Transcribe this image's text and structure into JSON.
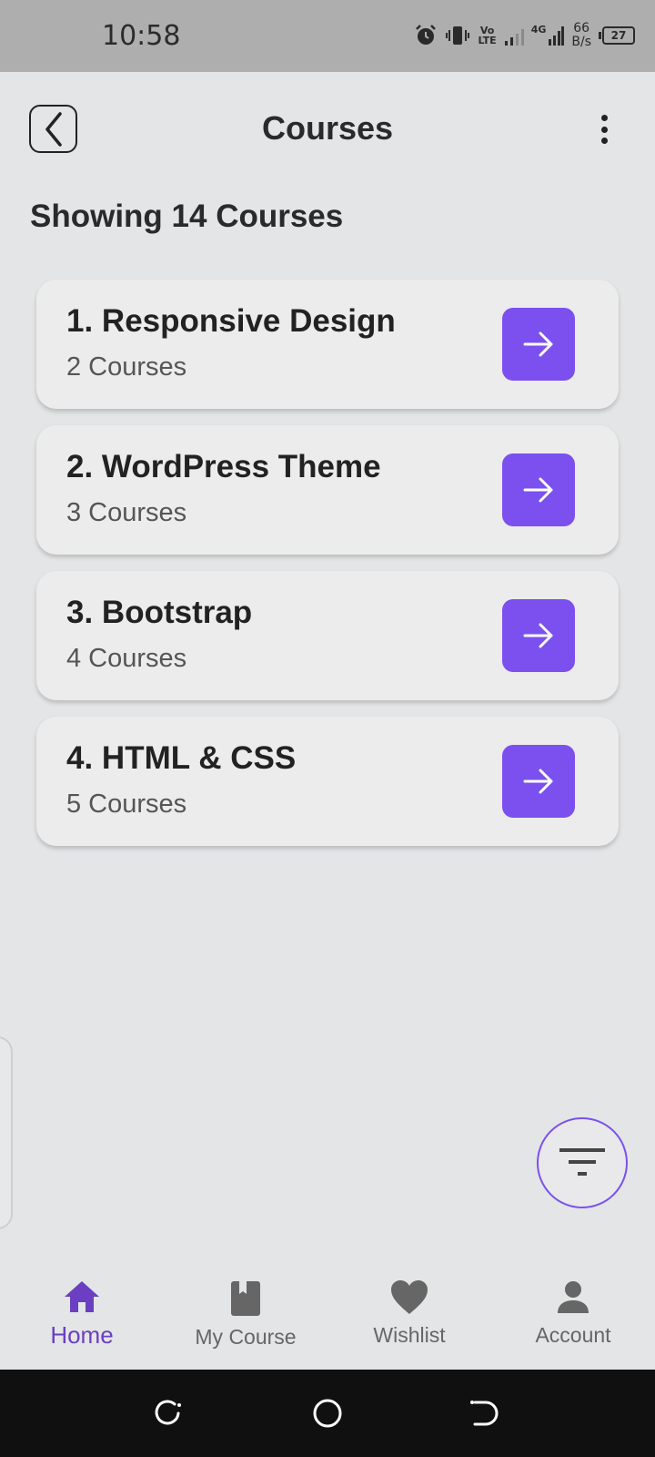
{
  "status_bar": {
    "time": "10:58",
    "network_vo": "Vo",
    "network_lte": "LTE",
    "network_4g": "4G",
    "speed_value": "66",
    "speed_unit": "B/s",
    "battery": "27",
    "icons": [
      "alarm-icon",
      "vibrate-icon",
      "signal-icon",
      "battery-icon"
    ]
  },
  "header": {
    "title": "Courses",
    "back_icon": "chevron-left-icon",
    "menu_icon": "more-vertical-icon"
  },
  "summary": {
    "showing_text": "Showing 14 Courses"
  },
  "courses": [
    {
      "title": "1. Responsive Design",
      "count": "2 Courses"
    },
    {
      "title": "2. WordPress Theme",
      "count": "3 Courses"
    },
    {
      "title": "3. Bootstrap",
      "count": "4 Courses"
    },
    {
      "title": "4. HTML & CSS",
      "count": "5 Courses"
    }
  ],
  "filter_button": {
    "icon": "filter-icon"
  },
  "bottom_nav": {
    "items": [
      {
        "label": "Home",
        "icon": "home-icon",
        "active": true
      },
      {
        "label": "My Course",
        "icon": "book-icon",
        "active": false
      },
      {
        "label": "Wishlist",
        "icon": "heart-icon",
        "active": false
      },
      {
        "label": "Account",
        "icon": "person-icon",
        "active": false
      }
    ]
  },
  "colors": {
    "accent": "#7b50ef",
    "active_nav": "#6a3fc1",
    "background": "#e3e5e6",
    "card": "#ececec"
  }
}
